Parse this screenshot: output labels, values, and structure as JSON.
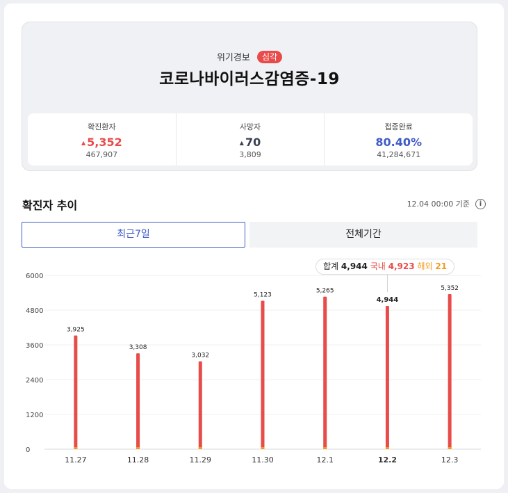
{
  "summary": {
    "alert_label": "위기경보",
    "alert_level": "심각",
    "disease_name": "코로나바이러스감염증-19",
    "stats": [
      {
        "label": "확진환자",
        "value": "5,352",
        "trend": "▲",
        "sub": "467,907",
        "color": "#e84c4a"
      },
      {
        "label": "사망자",
        "value": "70",
        "trend": "▲",
        "sub": "3,809",
        "color": "#3a4155"
      },
      {
        "label": "접종완료",
        "value": "80.40%",
        "trend": "",
        "sub": "41,284,671",
        "color": "#3f5bc5"
      }
    ]
  },
  "trend": {
    "title": "확진자 추이",
    "basis": "12.04 00:00 기준",
    "info_icon": "info-icon"
  },
  "tabs": {
    "recent": "최근7일",
    "all": "전체기간"
  },
  "tooltip": {
    "total_label": "합계",
    "total": "4,944",
    "domestic_label": "국내",
    "domestic": "4,923",
    "overseas_label": "해외",
    "overseas": "21"
  },
  "chart_data": {
    "type": "bar",
    "categories": [
      "11.27",
      "11.28",
      "11.29",
      "11.30",
      "12.1",
      "12.2",
      "12.3"
    ],
    "values": [
      3925,
      3308,
      3032,
      5123,
      5265,
      4944,
      5352
    ],
    "value_labels": [
      "3,925",
      "3,308",
      "3,032",
      "5,123",
      "5,265",
      "4,944",
      "5,352"
    ],
    "selected_index": 5,
    "ylim": [
      0,
      6000
    ],
    "yticks": [
      0,
      1200,
      2400,
      3600,
      4800,
      6000
    ],
    "grid": true,
    "bar_color": "#e84c4a",
    "base_marker_color": "#f39a1e",
    "title": "",
    "xlabel": "",
    "ylabel": ""
  }
}
